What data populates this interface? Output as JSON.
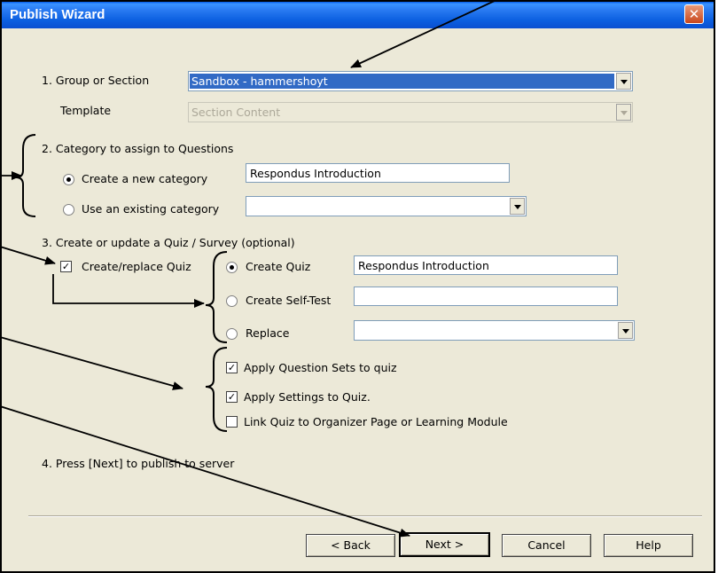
{
  "title": "Publish Wizard",
  "close_icon": "close-icon",
  "step1": {
    "label": "1.  Group or Section",
    "group_value": "Sandbox - hammershoyt",
    "template_label": "Template",
    "template_value": "Section Content"
  },
  "step2": {
    "label": "2.  Category to assign to Questions",
    "create_new": "Create a new category",
    "create_new_value": "Respondus Introduction",
    "use_existing": "Use an existing category",
    "use_existing_value": ""
  },
  "step3": {
    "label": "3.  Create or update a Quiz / Survey (optional)",
    "create_replace": "Create/replace Quiz",
    "create_quiz": "Create Quiz",
    "create_quiz_value": "Respondus Introduction",
    "create_selftest": "Create Self-Test",
    "create_selftest_value": "",
    "replace": "Replace",
    "replace_value": "",
    "apply_sets": "Apply Question Sets to quiz",
    "apply_settings": "Apply Settings to Quiz.",
    "link_quiz": "Link Quiz to Organizer Page or Learning Module"
  },
  "step4": {
    "label": "4.  Press [Next] to publish to server"
  },
  "buttons": {
    "back": "< Back",
    "next": "Next >",
    "cancel": "Cancel",
    "help": "Help"
  },
  "checks": {
    "create_replace": true,
    "apply_sets": true,
    "apply_settings": true,
    "link_quiz": false
  },
  "colors": {
    "titlebar": "#0a4fd1",
    "selection": "#316ac5",
    "dialog_bg": "#ece9d8"
  }
}
